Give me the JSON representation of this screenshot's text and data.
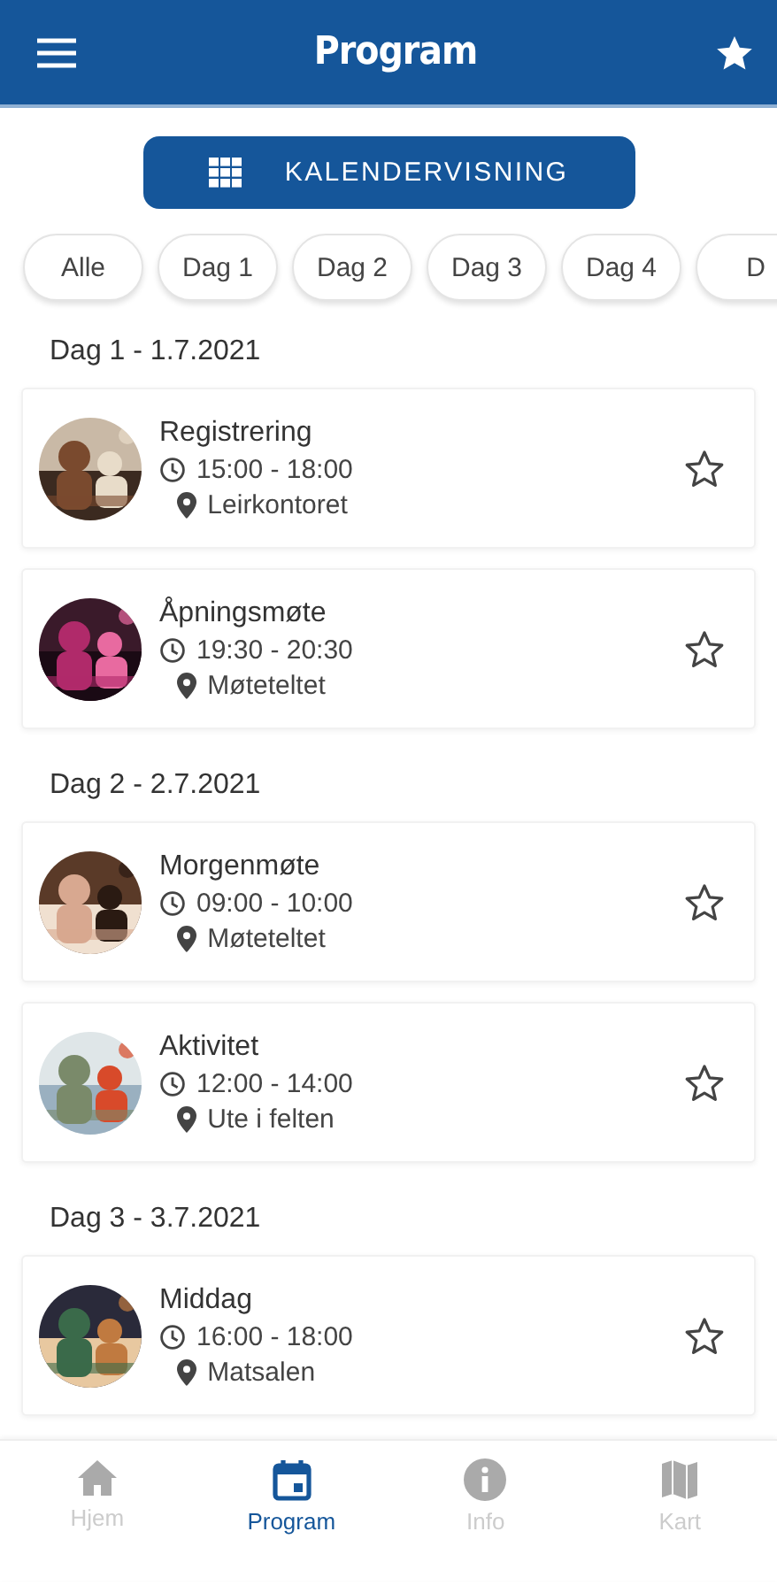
{
  "header": {
    "title": "Program"
  },
  "calendar_button": {
    "label": "KALENDERVISNING"
  },
  "day_filters": [
    {
      "label": "Alle",
      "selected": false
    },
    {
      "label": "Dag 1",
      "selected": false
    },
    {
      "label": "Dag 2",
      "selected": false
    },
    {
      "label": "Dag 3",
      "selected": false
    },
    {
      "label": "Dag 4",
      "selected": false
    },
    {
      "label": "D",
      "selected": false
    }
  ],
  "sections": [
    {
      "heading": "Dag 1 - 1.7.2021",
      "events": [
        {
          "title": "Registrering",
          "time": "15:00 - 18:00",
          "place": "Leirkontoret",
          "favorite": false
        },
        {
          "title": "Åpningsmøte",
          "time": "19:30 - 20:30",
          "place": "Møteteltet",
          "favorite": false
        }
      ]
    },
    {
      "heading": "Dag 2 - 2.7.2021",
      "events": [
        {
          "title": "Morgenmøte",
          "time": "09:00 - 10:00",
          "place": "Møteteltet",
          "favorite": false
        },
        {
          "title": "Aktivitet",
          "time": "12:00 - 14:00",
          "place": "Ute i felten",
          "favorite": false
        }
      ]
    },
    {
      "heading": "Dag 3 - 3.7.2021",
      "events": [
        {
          "title": "Middag",
          "time": "16:00 - 18:00",
          "place": "Matsalen",
          "favorite": false
        }
      ]
    }
  ],
  "bottom_nav": [
    {
      "label": "Hjem",
      "selected": false
    },
    {
      "label": "Program",
      "selected": true
    },
    {
      "label": "Info",
      "selected": false
    },
    {
      "label": "Kart",
      "selected": false
    }
  ]
}
